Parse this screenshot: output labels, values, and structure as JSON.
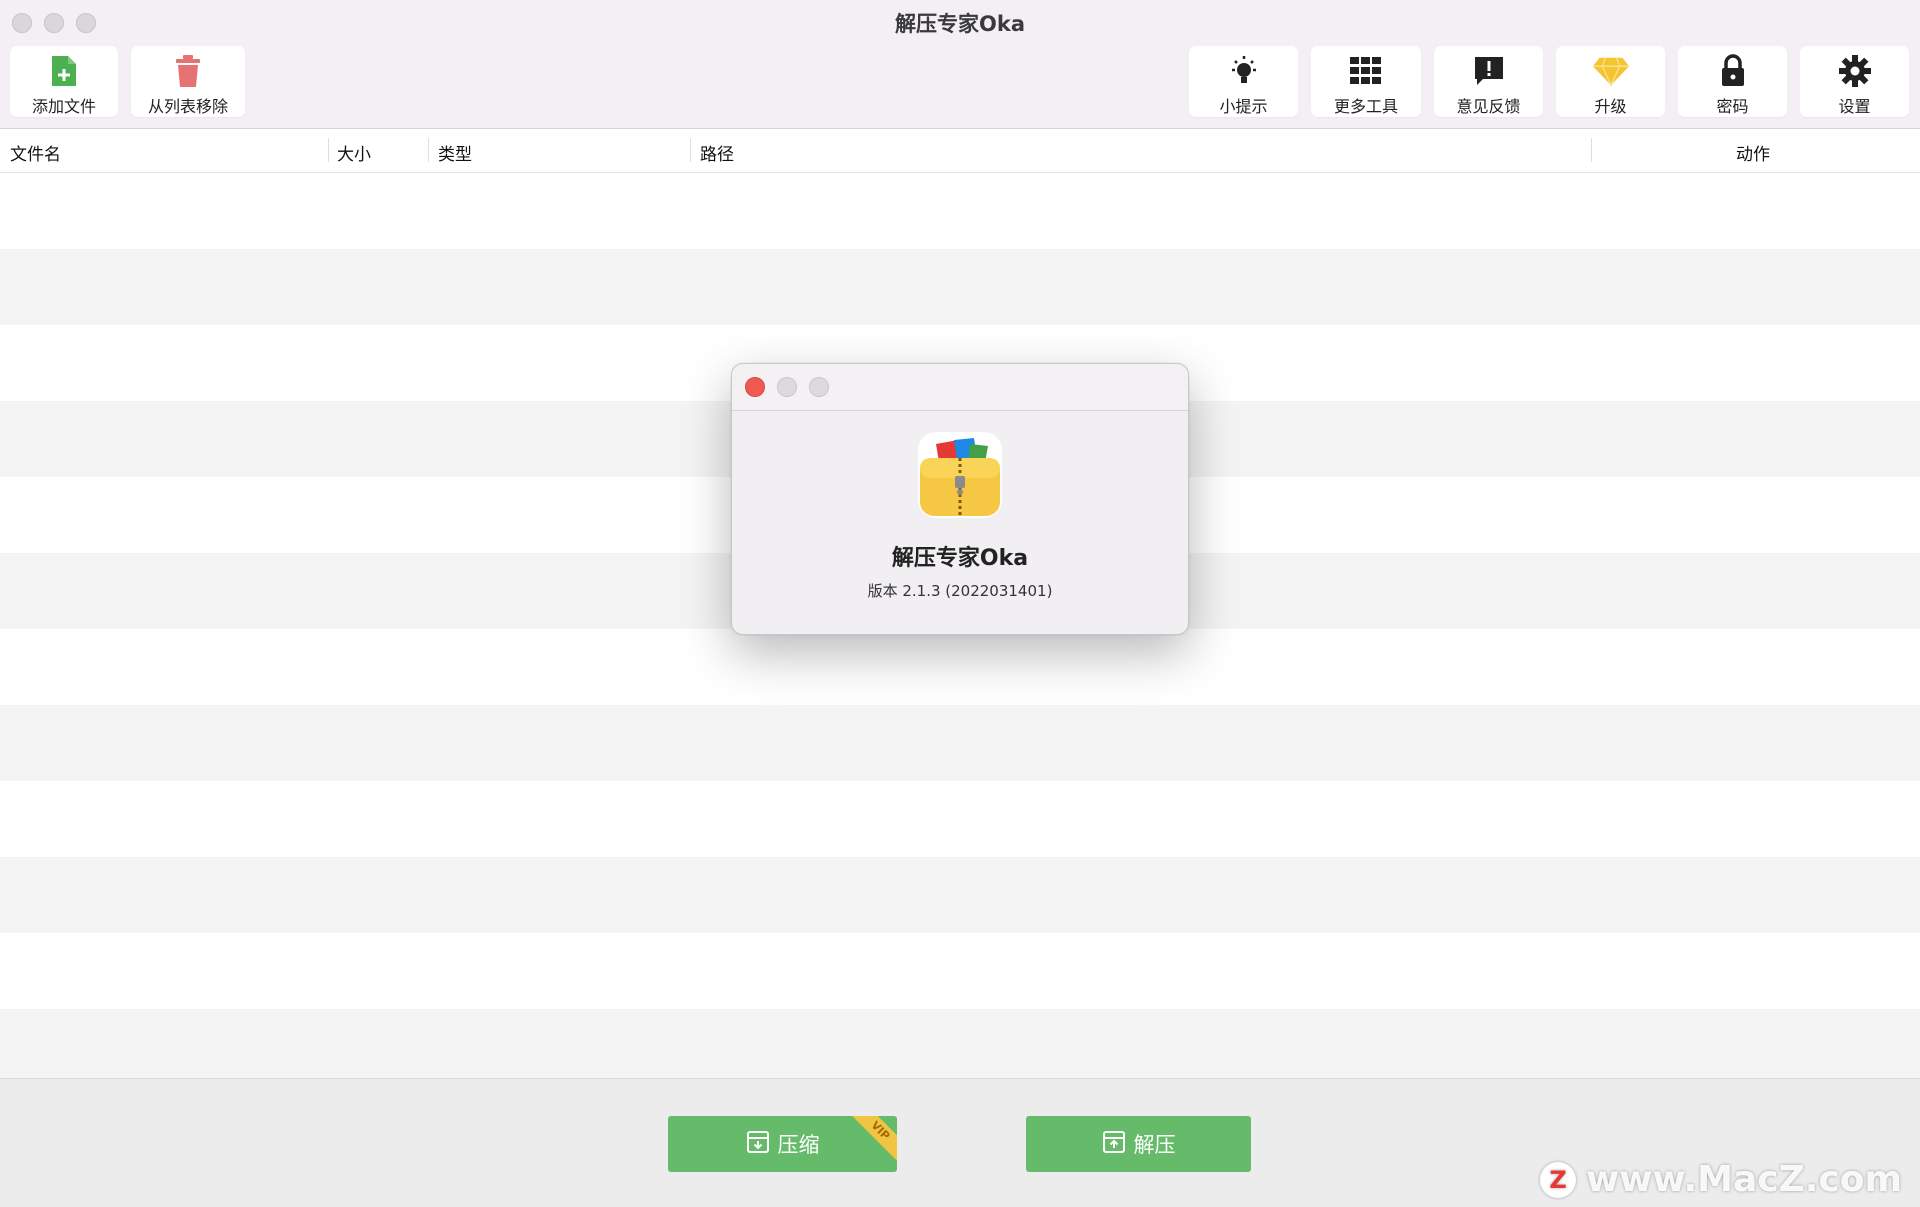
{
  "window": {
    "title": "解压专家Oka"
  },
  "toolbar": {
    "left": [
      {
        "id": "add-file",
        "label": "添加文件",
        "icon": "file-add-icon",
        "color": "#4caf50"
      },
      {
        "id": "remove-from-list",
        "label": "从列表移除",
        "icon": "trash-icon",
        "color": "#e57373"
      }
    ],
    "right": [
      {
        "id": "tips",
        "label": "小提示",
        "icon": "lightbulb-icon"
      },
      {
        "id": "more-tools",
        "label": "更多工具",
        "icon": "grid-icon"
      },
      {
        "id": "feedback",
        "label": "意见反馈",
        "icon": "feedback-icon"
      },
      {
        "id": "upgrade",
        "label": "升级",
        "icon": "diamond-icon",
        "color": "#f5c431"
      },
      {
        "id": "password",
        "label": "密码",
        "icon": "lock-icon"
      },
      {
        "id": "settings",
        "label": "设置",
        "icon": "gear-icon"
      }
    ]
  },
  "table": {
    "columns": [
      "文件名",
      "大小",
      "类型",
      "路径",
      "动作"
    ],
    "rows": []
  },
  "actions": {
    "compress_label": "压缩",
    "compress_badge": "VIP",
    "extract_label": "解压",
    "button_color": "#66bb6a"
  },
  "about": {
    "app_name": "解压专家Oka",
    "version": "版本 2.1.3 (2022031401)"
  },
  "watermark": {
    "logo": "Z",
    "text": "www.MacZ.com"
  }
}
